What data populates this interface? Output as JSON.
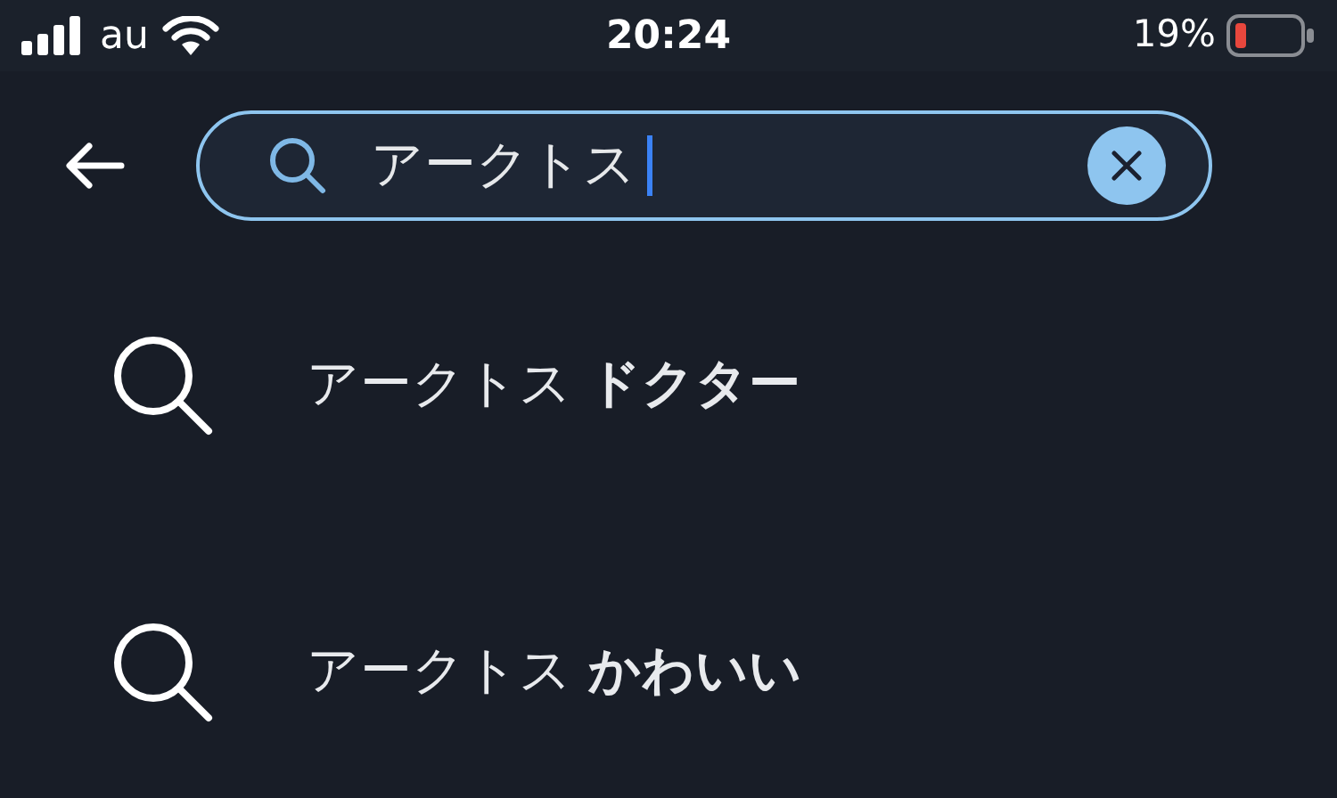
{
  "status_bar": {
    "carrier": "au",
    "time": "20:24",
    "battery": "19%"
  },
  "search": {
    "value": "アークトス"
  },
  "suggestions": [
    {
      "text": "アークトス **ドクター**"
    },
    {
      "text": "アークトス **かわいい**"
    }
  ]
}
